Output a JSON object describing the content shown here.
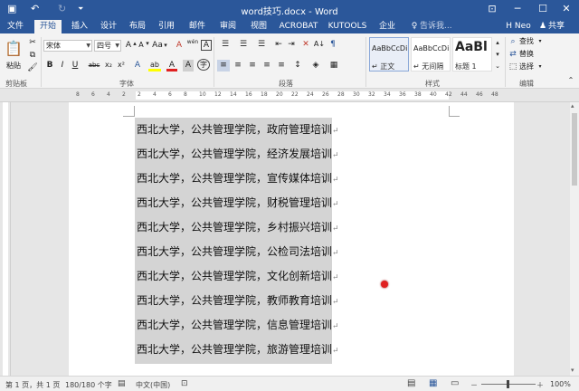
{
  "titlebar": {
    "title": "word技巧.docx - Word",
    "save_icon": "▣",
    "undo_icon": "↶",
    "redo_icon": "↻",
    "customize_icon": "⏷",
    "options_icon": "⊡",
    "min_icon": "─",
    "max_icon": "☐",
    "close_icon": "✕"
  },
  "tabs": [
    {
      "label": "文件"
    },
    {
      "label": "开始"
    },
    {
      "label": "插入"
    },
    {
      "label": "设计"
    },
    {
      "label": "布局"
    },
    {
      "label": "引用"
    },
    {
      "label": "邮件"
    },
    {
      "label": "审阅"
    },
    {
      "label": "视图"
    },
    {
      "label": "ACROBAT"
    },
    {
      "label": "KUTOOLS"
    },
    {
      "label": "企业"
    }
  ],
  "tellme": {
    "icon": "♀",
    "text": "告诉我..."
  },
  "user": {
    "name": "H Neo",
    "share": "共享",
    "share_icon": "♟"
  },
  "ribbon": {
    "clipboard": {
      "label": "剪贴板",
      "paste": "粘贴",
      "paste_icon": "📋",
      "cut_icon": "✂",
      "copy_icon": "⧉",
      "painter_icon": "🖌"
    },
    "font": {
      "label": "字体",
      "family": "宋体",
      "size": "四号",
      "grow": "A",
      "grow_arrow": "▴",
      "shrink": "A",
      "shrink_arrow": "▾",
      "case": "Aa",
      "case_arrow": "▾",
      "clear": "A",
      "phonetic": "wén",
      "border": "A",
      "bold": "B",
      "italic": "I",
      "underline": "U",
      "strike": "abc",
      "sub": "x₂",
      "sup": "x²",
      "effects": "A",
      "highlight": "ab",
      "color": "A",
      "shade": "A",
      "circle": "字"
    },
    "paragraph": {
      "label": "段落",
      "bullets": "☰",
      "numbering": "☰",
      "multilevel": "☰",
      "decrease": "⇤",
      "increase": "⇥",
      "chinese": "✕",
      "sort": "A↓",
      "marks": "¶",
      "align_left": "≡",
      "center": "≡",
      "align_right": "≡",
      "justify": "≡",
      "distributed": "≡",
      "spacing": "↕",
      "shading": "◈",
      "borders": "▦"
    },
    "styles": {
      "label": "样式",
      "items": [
        {
          "sample": "AaBbCcDi",
          "name": "↵ 正文"
        },
        {
          "sample": "AaBbCcDi",
          "name": "↵ 无间隔"
        },
        {
          "sample": "AaBl",
          "name": "标题 1"
        }
      ],
      "scroll_up": "▴",
      "scroll_down": "▾",
      "more": "⌄"
    },
    "editing": {
      "label": "编辑",
      "find": "查找",
      "find_icon": "⌕",
      "replace": "替换",
      "replace_icon": "⇄",
      "select": "选择",
      "select_icon": "⬚",
      "arrow": "▾"
    },
    "collapse_icon": "⌃"
  },
  "ruler_numbers": [
    "8",
    "6",
    "4",
    "2",
    "2",
    "4",
    "6",
    "8",
    "10",
    "12",
    "14",
    "16",
    "18",
    "20",
    "22",
    "24",
    "26",
    "28",
    "30",
    "32",
    "34",
    "36",
    "38",
    "40",
    "42",
    "44",
    "46",
    "48"
  ],
  "document": {
    "lines": [
      "西北大学，公共管理学院，政府管理培训",
      "西北大学，公共管理学院，经济发展培训",
      "西北大学，公共管理学院，宣传媒体培训",
      "西北大学，公共管理学院，财税管理培训",
      "西北大学，公共管理学院，乡村振兴培训",
      "西北大学，公共管理学院，公检司法培训",
      "西北大学，公共管理学院，文化创新培训",
      "西北大学，公共管理学院，教师教育培训",
      "西北大学，公共管理学院，信息管理培训",
      "西北大学，公共管理学院，旅游管理培训"
    ],
    "para_mark": "↵"
  },
  "statusbar": {
    "page": "第 1 页，共 1 页",
    "words": "180/180 个字",
    "proof_icon": "▤",
    "language": "中文(中国)",
    "macro_icon": "⊡",
    "zoom": "100%",
    "zoom_minus": "－",
    "zoom_plus": "＋",
    "view_read": "▤",
    "view_print": "▦",
    "view_web": "▭"
  },
  "scroll_up_icon": "▴",
  "scroll_down_icon": "▾"
}
